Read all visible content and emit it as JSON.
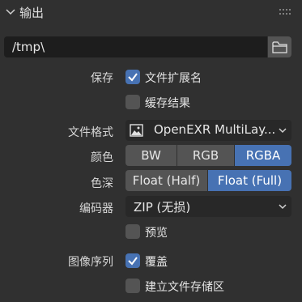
{
  "header": {
    "title": "输出"
  },
  "output_path": {
    "value": "/tmp\\"
  },
  "save": {
    "label": "保存",
    "file_extensions": {
      "label": "文件扩展名",
      "checked": true
    },
    "cache_result": {
      "label": "缓存结果",
      "checked": false
    }
  },
  "file_format": {
    "label": "文件格式",
    "value": "OpenEXR MultiLay..."
  },
  "color": {
    "label": "颜色",
    "options": [
      "BW",
      "RGB",
      "RGBA"
    ],
    "selected": "RGBA"
  },
  "color_depth": {
    "label": "色深",
    "options": [
      "Float (Half)",
      "Float (Full)"
    ],
    "selected": "Float (Full)"
  },
  "codec": {
    "label": "编码器",
    "value": "ZIP (无损)"
  },
  "preview": {
    "label": "预览",
    "checked": false
  },
  "image_sequence": {
    "label": "图像序列",
    "overwrite": {
      "label": "覆盖",
      "checked": true
    },
    "placeholders": {
      "label": "建立文件存储区",
      "checked": false
    }
  },
  "colors": {
    "background": "#303030",
    "accent": "#4772b3",
    "button": "#545454",
    "field": "#1d1d1d"
  }
}
